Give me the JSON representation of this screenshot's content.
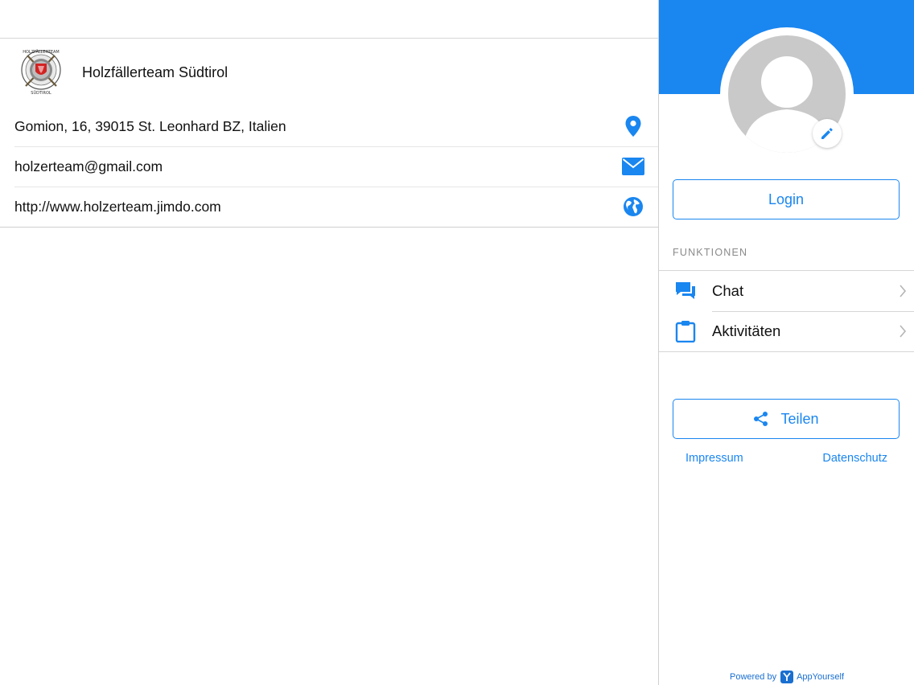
{
  "organization": {
    "name": "Holzfällerteam Südtirol",
    "logo_text_top": "HOLZFÄLLERTEAM",
    "logo_text_bottom": "SÜDTIROL"
  },
  "contact": {
    "address": "Gomion, 16, 39015 St. Leonhard BZ, Italien",
    "email": "holzerteam@gmail.com",
    "website": "http://www.holzerteam.jimdo.com"
  },
  "sidebar": {
    "login_label": "Login",
    "section_label": "FUNKTIONEN",
    "menu": [
      {
        "label": "Chat",
        "icon": "chat-icon"
      },
      {
        "label": "Aktivitäten",
        "icon": "clipboard-icon"
      }
    ],
    "share_label": "Teilen",
    "links": {
      "impressum": "Impressum",
      "datenschutz": "Datenschutz"
    },
    "powered_by": "Powered by",
    "brand": "AppYourself"
  },
  "colors": {
    "accent": "#1a86f0",
    "avatar_bg": "#c9c9c9"
  }
}
